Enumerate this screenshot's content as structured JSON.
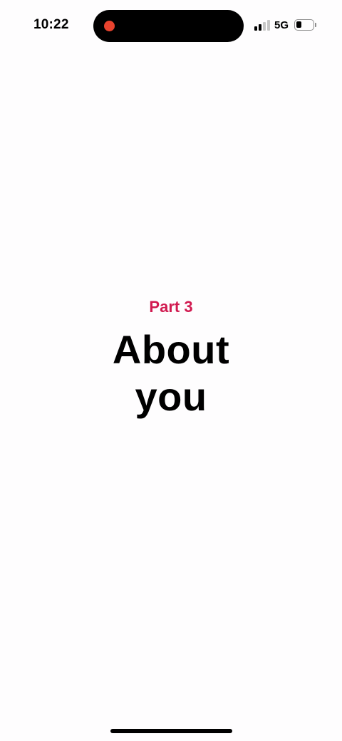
{
  "status_bar": {
    "time": "10:22",
    "network": "5G",
    "signal_bars_active": 2,
    "signal_bars_total": 4,
    "battery_percent": 35,
    "recording_color": "#e8432e"
  },
  "screen": {
    "part_label": "Part 3",
    "title": "About you",
    "accent_color": "#d11a50",
    "background_color": "#fefdfe"
  },
  "icons": {
    "signal": "cellular-signal-icon",
    "battery": "battery-icon",
    "record": "screen-recording-dot-icon"
  }
}
